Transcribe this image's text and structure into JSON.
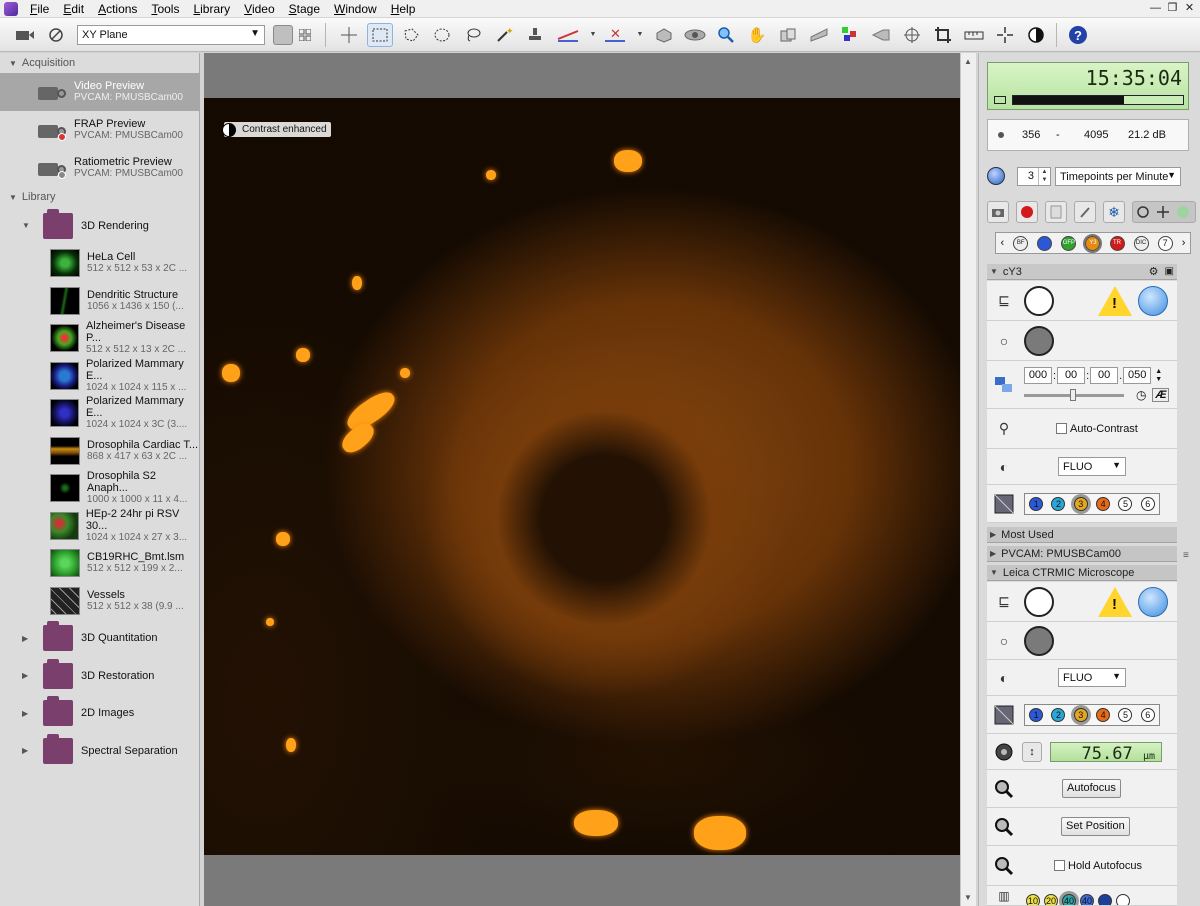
{
  "menubar": {
    "items": [
      "File",
      "Edit",
      "Actions",
      "Tools",
      "Library",
      "Video",
      "Stage",
      "Window",
      "Help"
    ]
  },
  "toolbar": {
    "plane_select": "XY Plane"
  },
  "left_panel": {
    "acquisition_header": "Acquisition",
    "acquisition_items": [
      {
        "title": "Video Preview",
        "sub": "PVCAM: PMUSBCam00"
      },
      {
        "title": "FRAP Preview",
        "sub": "PVCAM: PMUSBCam00"
      },
      {
        "title": "Ratiometric Preview",
        "sub": "PVCAM: PMUSBCam00"
      }
    ],
    "library_header": "Library",
    "open_folder": "3D Rendering",
    "library_items": [
      {
        "title": "HeLa Cell",
        "sub": "512 x 512 x 53 x 2C ..."
      },
      {
        "title": "Dendritic Structure",
        "sub": "1056 x 1436 x 150 (..."
      },
      {
        "title": "Alzheimer's Disease P...",
        "sub": "512 x 512 x 13 x 2C ..."
      },
      {
        "title": "Polarized Mammary E...",
        "sub": "1024 x 1024 x 115 x ..."
      },
      {
        "title": "Polarized Mammary E...",
        "sub": "1024 x 1024 x 3C (3...."
      },
      {
        "title": "Drosophila Cardiac T...",
        "sub": "868 x 417 x 63 x 2C ..."
      },
      {
        "title": "Drosophila S2 Anaph...",
        "sub": "1000 x 1000 x 11 x 4..."
      },
      {
        "title": "HEp-2 24hr pi RSV 30...",
        "sub": "1024 x 1024 x 27 x 3..."
      },
      {
        "title": "CB19RHC_Bmt.lsm",
        "sub": "512 x 512 x 199 x 2..."
      },
      {
        "title": "Vessels",
        "sub": "512 x 512 x 38 (9.9 ..."
      }
    ],
    "folders": [
      "3D Quantitation",
      "3D Restoration",
      "2D Images",
      "Spectral Separation"
    ]
  },
  "viewer": {
    "contrast_label": "Contrast enhanced"
  },
  "right_panel": {
    "clock": "15:35:04",
    "stats": {
      "min": "356",
      "sep": "-",
      "max": "4095",
      "db": "21.2 dB"
    },
    "timepoints_value": "3",
    "timepoints_unit": "Timepoints per Minute",
    "channels": [
      "BF",
      "",
      "GFP",
      "Y3",
      "TR",
      "DIC",
      "7"
    ],
    "cy3_header": "cY3",
    "exposure": {
      "h": "000",
      "m": "00",
      "s": "00",
      "ms": "050"
    },
    "auto_contrast_label": "Auto-Contrast",
    "fluo_select_1": "FLUO",
    "mini_channels_1": [
      "1",
      "2",
      "3",
      "4",
      "5",
      "6"
    ],
    "most_used_header": "Most Used",
    "pvcam_header": "PVCAM: PMUSBCam00",
    "leica_header": "Leica CTRMIC Microscope",
    "fluo_select_2": "FLUO",
    "mini_channels_2": [
      "1",
      "2",
      "3",
      "4",
      "5",
      "6"
    ],
    "z_value": "75.67",
    "z_unit": "µm",
    "autofocus_label": "Autofocus",
    "set_position_label": "Set Position",
    "hold_autofocus_label": "Hold Autofocus",
    "bottom_chans": [
      "10",
      "20",
      "40",
      "40",
      "",
      ""
    ]
  }
}
